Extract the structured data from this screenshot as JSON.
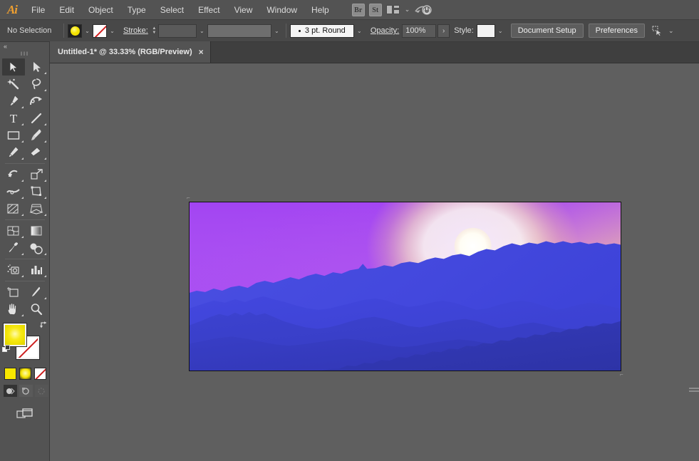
{
  "app": {
    "name": "Adobe Illustrator",
    "logo_text": "Ai"
  },
  "menubar": {
    "items": [
      {
        "label": "File",
        "name": "menu-file"
      },
      {
        "label": "Edit",
        "name": "menu-edit"
      },
      {
        "label": "Object",
        "name": "menu-object"
      },
      {
        "label": "Type",
        "name": "menu-type"
      },
      {
        "label": "Select",
        "name": "menu-select"
      },
      {
        "label": "Effect",
        "name": "menu-effect"
      },
      {
        "label": "View",
        "name": "menu-view"
      },
      {
        "label": "Window",
        "name": "menu-window"
      },
      {
        "label": "Help",
        "name": "menu-help"
      }
    ],
    "bridge_label": "Br",
    "stock_label": "St",
    "arrange_icon": "arrange-documents-icon",
    "arrange_chevron": "⌄",
    "workspace_icon": "workspace-switcher-icon"
  },
  "controlbar": {
    "selection_status": "No Selection",
    "fill_icon": "fill-swatch-icon",
    "fill_color": "#f5e400",
    "fill_chevron": "⌄",
    "stroke_icon": "stroke-swatch-none-icon",
    "stroke_color": "#ffffff",
    "stroke_chevron": "⌄",
    "stroke_label": "Stroke:",
    "stroke_weight_value": "",
    "stroke_weight_chevron": "⌄",
    "stroke_profile_value": "",
    "stroke_profile_chevron": "⌄",
    "brush_definition": "3 pt. Round",
    "brush_chevron": "⌄",
    "opacity_label": "Opacity:",
    "opacity_value": "100%",
    "opacity_more": "›",
    "style_label": "Style:",
    "style_swatch_color": "#f2f2f2",
    "style_chevron": "⌄",
    "document_setup_label": "Document Setup",
    "preferences_label": "Preferences",
    "align_icon": "align-to-selection-icon",
    "align_chevron": "⌄"
  },
  "tabbar": {
    "tab_title": "Untitled-1* @ 33.33% (RGB/Preview)",
    "close_glyph": "×"
  },
  "toolpanel": {
    "collapse_glyph": "«",
    "grip_glyph": "‖‖‖",
    "tools": [
      {
        "name": "selection-tool-icon",
        "label": "Selection",
        "active": true
      },
      {
        "name": "direct-selection-tool-icon",
        "label": "Direct Selection",
        "active": false
      },
      {
        "name": "magic-wand-tool-icon",
        "label": "Magic Wand",
        "active": false
      },
      {
        "name": "lasso-tool-icon",
        "label": "Lasso",
        "active": false
      },
      {
        "name": "pen-tool-icon",
        "label": "Pen",
        "active": false
      },
      {
        "name": "curvature-tool-icon",
        "label": "Curvature",
        "active": false
      },
      {
        "name": "type-tool-icon",
        "label": "Type",
        "active": false
      },
      {
        "name": "line-segment-tool-icon",
        "label": "Line Segment",
        "active": false
      },
      {
        "name": "rectangle-tool-icon",
        "label": "Rectangle",
        "active": false
      },
      {
        "name": "paintbrush-tool-icon",
        "label": "Paintbrush",
        "active": false
      },
      {
        "name": "pencil-tool-icon",
        "label": "Pencil",
        "active": false
      },
      {
        "name": "eraser-tool-icon",
        "label": "Eraser",
        "active": false
      },
      {
        "name": "rotate-tool-icon",
        "label": "Rotate",
        "active": false
      },
      {
        "name": "scale-tool-icon",
        "label": "Scale",
        "active": false
      },
      {
        "name": "width-tool-icon",
        "label": "Width",
        "active": false
      },
      {
        "name": "free-transform-tool-icon",
        "label": "Free Transform",
        "active": false
      },
      {
        "name": "shape-builder-tool-icon",
        "label": "Shape Builder",
        "active": false
      },
      {
        "name": "perspective-grid-tool-icon",
        "label": "Perspective Grid",
        "active": false
      },
      {
        "name": "mesh-tool-icon",
        "label": "Mesh",
        "active": false
      },
      {
        "name": "gradient-tool-icon",
        "label": "Gradient",
        "active": false
      },
      {
        "name": "eyedropper-tool-icon",
        "label": "Eyedropper",
        "active": false
      },
      {
        "name": "blend-tool-icon",
        "label": "Blend",
        "active": false
      },
      {
        "name": "symbol-sprayer-tool-icon",
        "label": "Symbol Sprayer",
        "active": false
      },
      {
        "name": "column-graph-tool-icon",
        "label": "Column Graph",
        "active": false
      },
      {
        "name": "artboard-tool-icon",
        "label": "Artboard",
        "active": false
      },
      {
        "name": "slice-tool-icon",
        "label": "Slice",
        "active": false
      },
      {
        "name": "hand-tool-icon",
        "label": "Hand",
        "active": false
      },
      {
        "name": "zoom-tool-icon",
        "label": "Zoom",
        "active": false
      }
    ],
    "fill_swatch": {
      "name": "fill-color-swatch",
      "color": "#f5e400"
    },
    "stroke_swatch": {
      "name": "stroke-color-swatch",
      "color": "#ffffff"
    },
    "swap_icon": "swap-fill-stroke-icon",
    "default_icon": "default-fill-stroke-icon",
    "paint_modes": [
      {
        "name": "color-button",
        "label": "Color"
      },
      {
        "name": "gradient-button",
        "label": "Gradient"
      },
      {
        "name": "none-button",
        "label": "None"
      }
    ],
    "draw_modes": [
      {
        "name": "draw-normal-button",
        "label": "Draw Normal",
        "active": true
      },
      {
        "name": "draw-behind-button",
        "label": "Draw Behind",
        "active": false
      },
      {
        "name": "draw-inside-button",
        "label": "Draw Inside",
        "active": false
      }
    ],
    "screen_mode": {
      "name": "change-screen-mode-button",
      "label": "Change Screen Mode"
    }
  },
  "canvas": {
    "zoom_level": "33.33%",
    "artwork": {
      "title": "Mountain Sunset Landscape",
      "sky_top_color": "#a855f0",
      "sky_glow_color": "#f7d7a8",
      "sun_color": "#fffdf2",
      "ridge_colors": [
        "#4a4ee0",
        "#3f45d4",
        "#383fc4",
        "#3339b4",
        "#2f35a6"
      ]
    }
  }
}
